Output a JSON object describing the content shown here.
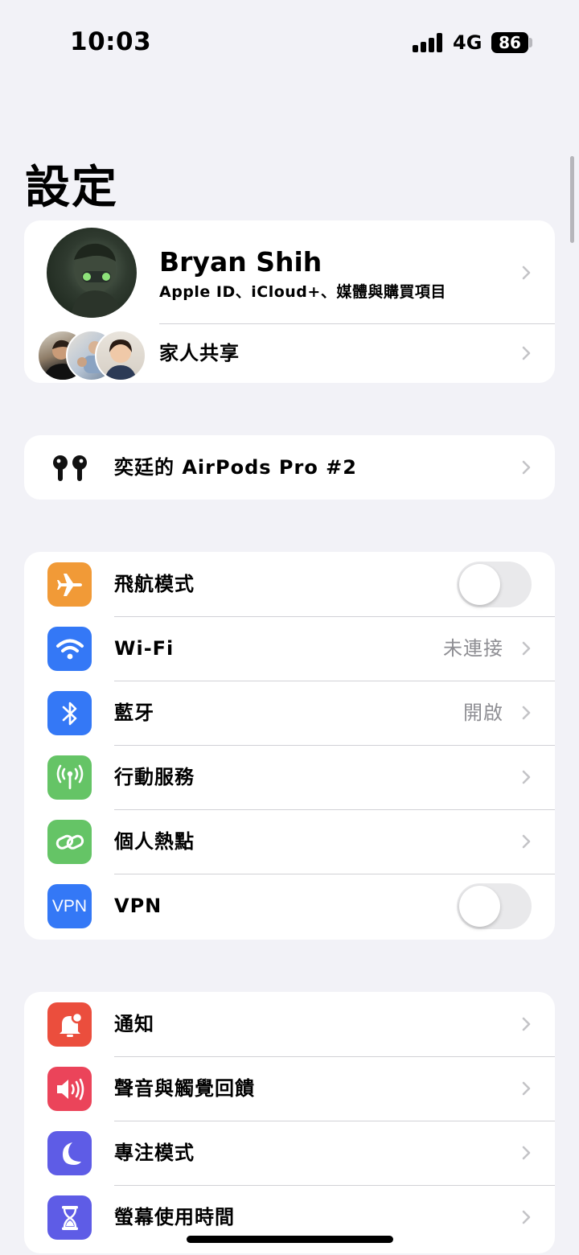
{
  "status_bar": {
    "time": "10:03",
    "network": "4G",
    "battery": "86"
  },
  "page_title": "設定",
  "profile": {
    "name": "Bryan Shih",
    "subtitle": "Apple ID、iCloud+、媒體與購買項目",
    "family_label": "家人共享"
  },
  "device": {
    "label": "奕廷的 AirPods Pro #2",
    "icon": "airpods-icon"
  },
  "connectivity": {
    "airplane": {
      "label": "飛航模式",
      "icon": "airplane-icon",
      "color": "#f19a37",
      "toggle_on": false
    },
    "wifi": {
      "label": "Wi-Fi",
      "value": "未連接",
      "icon": "wifi-icon",
      "color": "#3478f6"
    },
    "bluetooth": {
      "label": "藍牙",
      "value": "開啟",
      "icon": "bluetooth-icon",
      "color": "#3478f6"
    },
    "cellular": {
      "label": "行動服務",
      "icon": "antenna-icon",
      "color": "#65c466"
    },
    "hotspot": {
      "label": "個人熱點",
      "icon": "hotspot-icon",
      "color": "#65c466"
    },
    "vpn": {
      "label": "VPN",
      "icon_text": "VPN",
      "color": "#3478f6",
      "toggle_on": false
    }
  },
  "notifications_group": {
    "notifications": {
      "label": "通知",
      "icon": "bell-icon",
      "color": "#eb4e3d"
    },
    "sounds": {
      "label": "聲音與觸覺回饋",
      "icon": "speaker-icon",
      "color": "#eb445a"
    },
    "focus": {
      "label": "專注模式",
      "icon": "moon-icon",
      "color": "#5e5ce6"
    },
    "screen_time": {
      "label": "螢幕使用時間",
      "icon": "hourglass-icon",
      "color": "#5e5ce6"
    }
  }
}
